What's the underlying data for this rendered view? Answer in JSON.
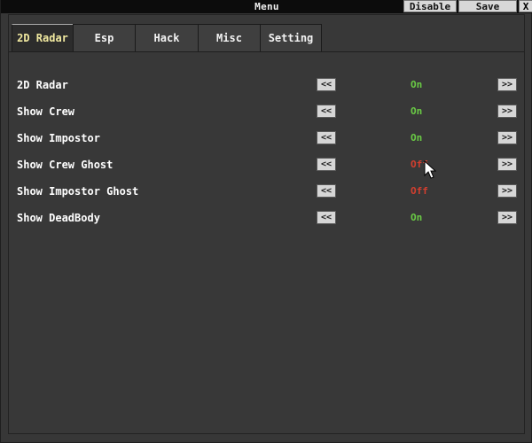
{
  "titlebar": {
    "title": "Menu",
    "disable_label": "Disable",
    "save_label": "Save",
    "close_label": "X"
  },
  "tabs": [
    {
      "label": "2D Radar",
      "active": true
    },
    {
      "label": "Esp",
      "active": false
    },
    {
      "label": "Hack",
      "active": false
    },
    {
      "label": "Misc",
      "active": false
    },
    {
      "label": "Setting",
      "active": false
    }
  ],
  "rows": [
    {
      "label": "2D Radar",
      "state": "On"
    },
    {
      "label": "Show Crew",
      "state": "On"
    },
    {
      "label": "Show Impostor",
      "state": "On"
    },
    {
      "label": "Show Crew Ghost",
      "state": "Off"
    },
    {
      "label": "Show Impostor Ghost",
      "state": "Off"
    },
    {
      "label": "Show DeadBody",
      "state": "On"
    }
  ],
  "controls": {
    "prev_label": "<<",
    "next_label": ">>"
  },
  "colors": {
    "on": "#6acb45",
    "off": "#d33f2f",
    "active_tab_text": "#f1e9a0"
  }
}
